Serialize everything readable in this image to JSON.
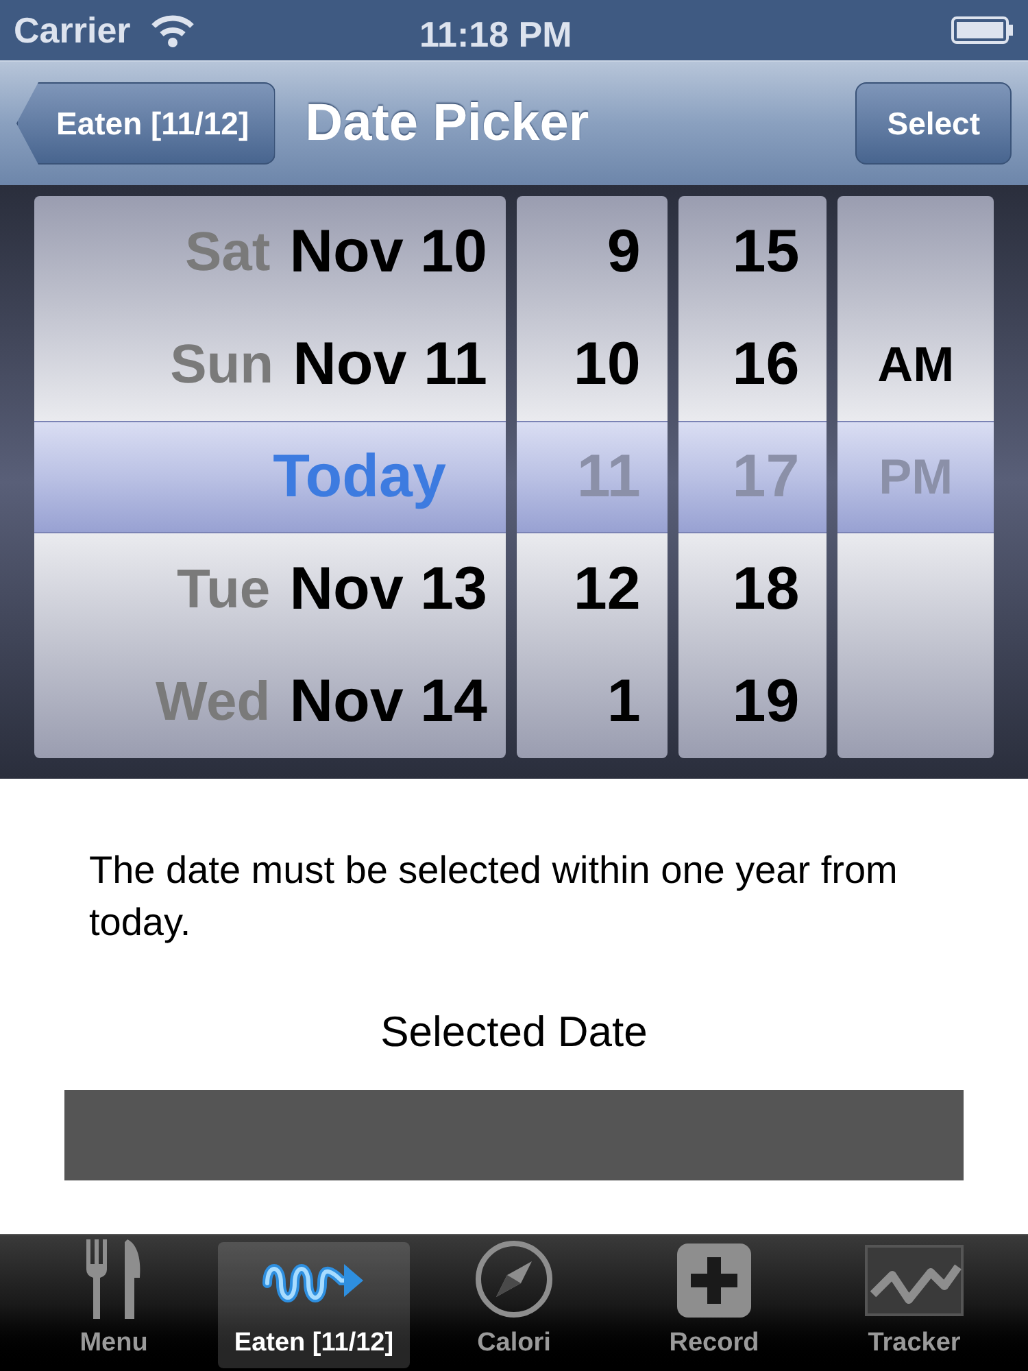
{
  "status_bar": {
    "carrier": "Carrier",
    "time": "11:18 PM"
  },
  "nav_bar": {
    "back_button": "Eaten [11/12]",
    "title": "Date Picker",
    "action_button": "Select"
  },
  "picker": {
    "columns": [
      {
        "kind": "date",
        "items": [
          {
            "weekday": "Sat",
            "date": "Nov 10",
            "selected": false
          },
          {
            "weekday": "Sun",
            "date": "Nov 11",
            "selected": false
          },
          {
            "date": "Today",
            "selected": true
          },
          {
            "weekday": "Tue",
            "date": "Nov 13",
            "selected": false
          },
          {
            "weekday": "Wed",
            "date": "Nov 14",
            "selected": false
          }
        ]
      },
      {
        "kind": "number",
        "items": [
          {
            "label": "9",
            "selected": false
          },
          {
            "label": "10",
            "selected": false
          },
          {
            "label": "11",
            "selected": true
          },
          {
            "label": "12",
            "selected": false
          },
          {
            "label": "1",
            "selected": false
          }
        ]
      },
      {
        "kind": "number",
        "items": [
          {
            "label": "15",
            "selected": false
          },
          {
            "label": "16",
            "selected": false
          },
          {
            "label": "17",
            "selected": true
          },
          {
            "label": "18",
            "selected": false
          },
          {
            "label": "19",
            "selected": false
          }
        ]
      },
      {
        "kind": "meridiem",
        "items": [
          {
            "label": "AM",
            "selected": false
          },
          {
            "label": "PM",
            "selected": true
          }
        ]
      }
    ]
  },
  "message": "The date must be selected within one year from today.",
  "selected_date": {
    "label": "Selected Date"
  },
  "tab_bar": [
    {
      "label": "Menu",
      "selected": false
    },
    {
      "label": "Eaten [11/12]",
      "selected": true
    },
    {
      "label": "Calori",
      "selected": false
    },
    {
      "label": "Record",
      "selected": false
    },
    {
      "label": "Tracker",
      "selected": false
    }
  ]
}
